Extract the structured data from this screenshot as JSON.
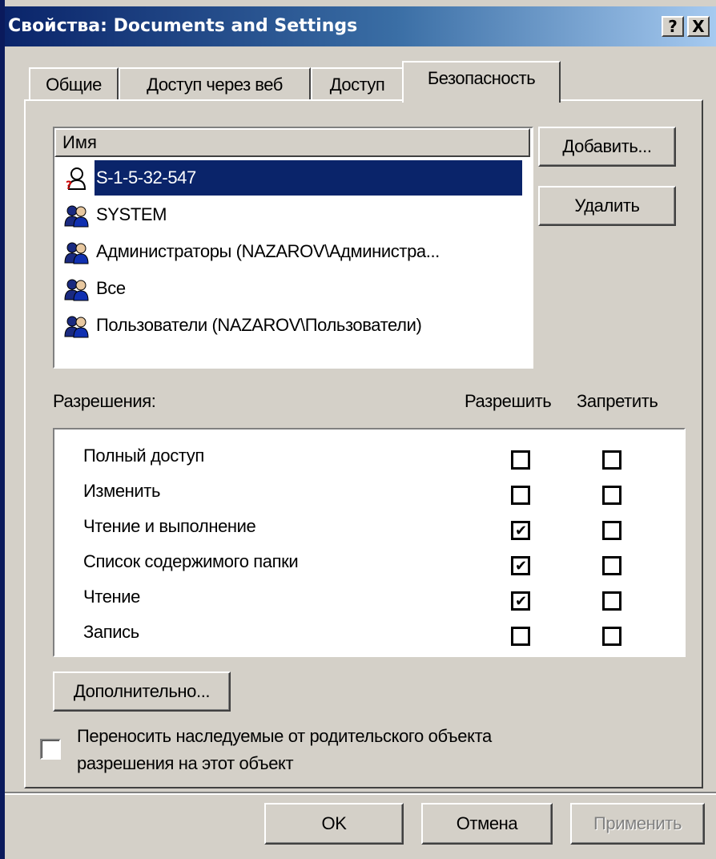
{
  "dialog": {
    "title": "Свойства: Documents and Settings",
    "help_button": "?",
    "close_button": "X"
  },
  "tabs": [
    {
      "label": "Общие"
    },
    {
      "label": "Доступ через веб"
    },
    {
      "label": "Доступ"
    },
    {
      "label": "Безопасность",
      "active": true
    }
  ],
  "users_list": {
    "header": "Имя",
    "items": [
      {
        "label": "S-1-5-32-547",
        "icon": "unknown-user-icon",
        "selected": true
      },
      {
        "label": "SYSTEM",
        "icon": "user-group-icon"
      },
      {
        "label": "Администраторы (NAZAROV\\Администра...",
        "icon": "user-group-icon"
      },
      {
        "label": "Все",
        "icon": "user-group-icon"
      },
      {
        "label": "Пользователи (NAZAROV\\Пользователи)",
        "icon": "user-group-icon"
      }
    ]
  },
  "buttons": {
    "add": "Добавить...",
    "remove": "Удалить",
    "advanced": "Дополнительно...",
    "ok": "OK",
    "cancel": "Отмена",
    "apply": "Применить"
  },
  "permissions": {
    "label": "Разрешения:",
    "allow_header": "Разрешить",
    "deny_header": "Запретить",
    "rows": [
      {
        "name": "Полный доступ",
        "allow": false,
        "deny": false
      },
      {
        "name": "Изменить",
        "allow": false,
        "deny": false
      },
      {
        "name": "Чтение и выполнение",
        "allow": true,
        "deny": false
      },
      {
        "name": "Список содержимого папки",
        "allow": true,
        "deny": false
      },
      {
        "name": "Чтение",
        "allow": true,
        "deny": false
      },
      {
        "name": "Запись",
        "allow": false,
        "deny": false
      }
    ]
  },
  "inherit": {
    "line1": "Переносить наследуемые от родительского объекта",
    "line2": "разрешения на этот объект",
    "checked": false
  },
  "colors": {
    "titlebar_start": "#0a246a",
    "titlebar_end": "#a6caf0",
    "selection": "#0a246a",
    "face": "#d4d0c8",
    "disabled_text": "#808080"
  }
}
